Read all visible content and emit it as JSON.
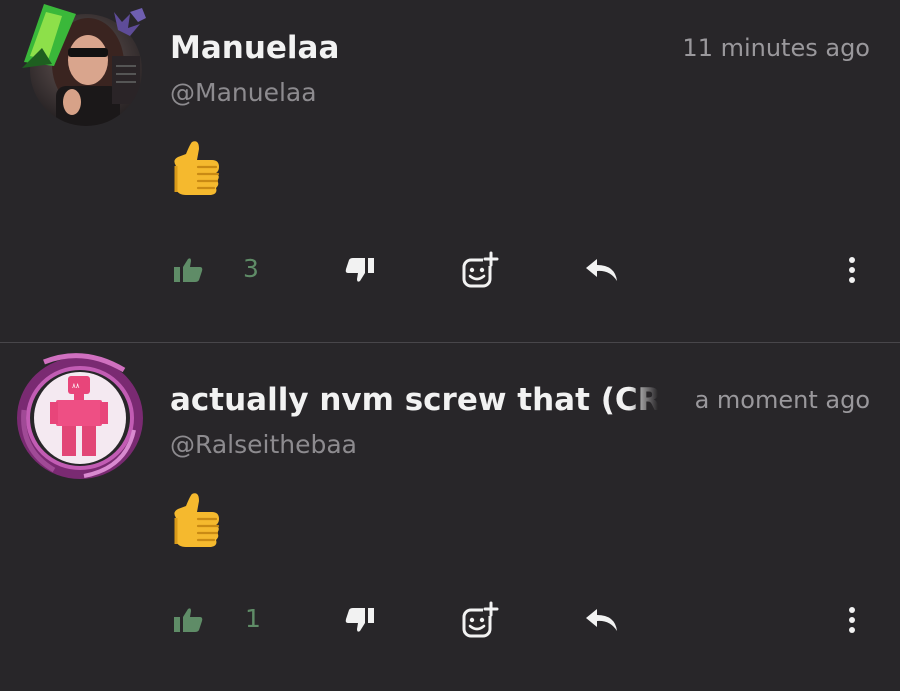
{
  "comments": [
    {
      "username": "Manuelaa",
      "handle": "@Manuelaa",
      "timestamp": "11 minutes ago",
      "body_emoji": "thumbs-up",
      "like_count": "3"
    },
    {
      "username": "actually nvm screw that (CRE",
      "handle": "@Ralseithebaa",
      "timestamp": "a moment ago",
      "body_emoji": "thumbs-up",
      "like_count": "1"
    }
  ],
  "colors": {
    "background": "#282629",
    "like_green": "#5f8c67",
    "text_primary": "#f2f2f2",
    "text_secondary": "#8d8b8f"
  },
  "icons": {
    "like": "thumbs-up-icon",
    "dislike": "thumbs-down-icon",
    "react": "add-reaction-icon",
    "reply": "reply-icon",
    "more": "more-vertical-icon"
  }
}
